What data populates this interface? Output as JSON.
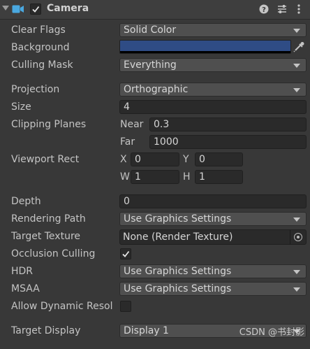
{
  "header": {
    "title": "Camera",
    "enabled": true,
    "icons": [
      "camera-icon",
      "help-icon",
      "presets-icon",
      "more-options-icon"
    ]
  },
  "fields": {
    "clear_flags": {
      "label": "Clear Flags",
      "value": "Solid Color"
    },
    "background": {
      "label": "Background",
      "color": "#2f4c85"
    },
    "culling_mask": {
      "label": "Culling Mask",
      "value": "Everything"
    },
    "projection": {
      "label": "Projection",
      "value": "Orthographic"
    },
    "size": {
      "label": "Size",
      "value": "4"
    },
    "clipping_planes": {
      "label": "Clipping Planes",
      "near_label": "Near",
      "near": "0.3",
      "far_label": "Far",
      "far": "1000"
    },
    "viewport_rect": {
      "label": "Viewport Rect",
      "x_label": "X",
      "x": "0",
      "y_label": "Y",
      "y": "0",
      "w_label": "W",
      "w": "1",
      "h_label": "H",
      "h": "1"
    },
    "depth": {
      "label": "Depth",
      "value": "0"
    },
    "rendering_path": {
      "label": "Rendering Path",
      "value": "Use Graphics Settings"
    },
    "target_texture": {
      "label": "Target Texture",
      "value": "None (Render Texture)"
    },
    "occlusion_culling": {
      "label": "Occlusion Culling",
      "checked": true
    },
    "hdr": {
      "label": "HDR",
      "value": "Use Graphics Settings"
    },
    "msaa": {
      "label": "MSAA",
      "value": "Use Graphics Settings"
    },
    "allow_dynamic_resolution": {
      "label": "Allow Dynamic Resol",
      "checked": false
    },
    "target_display": {
      "label": "Target Display",
      "value": "Display 1"
    }
  },
  "watermark": "CSDN @书封影"
}
